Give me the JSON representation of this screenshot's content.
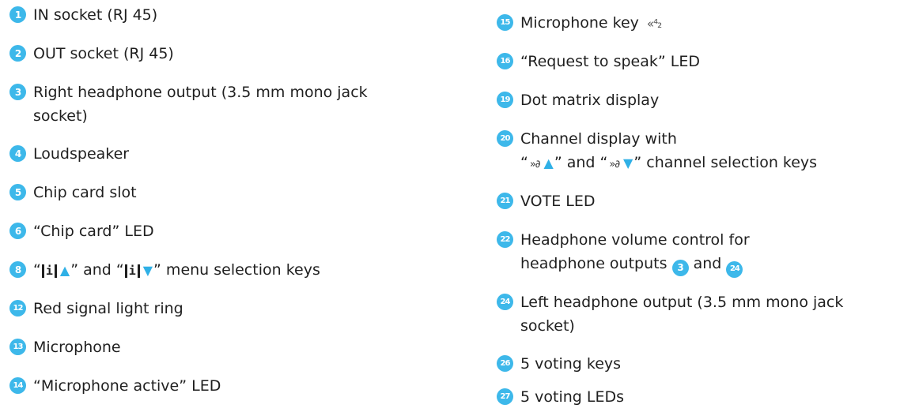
{
  "colors": {
    "badge": "#3db8ea",
    "badge_alt": "#33c6b8",
    "text": "#1f1f1f",
    "triangle": "#2fb0e6"
  },
  "symbols": {
    "open_quote": "“",
    "close_quote": "”",
    "menu_icon": "i",
    "ear_icon": "»∂",
    "up": "▲",
    "down": "▼",
    "mic_key_icon": "«⁴₂"
  },
  "left_items": [
    {
      "num": "1",
      "text": "IN socket (RJ 45)"
    },
    {
      "num": "2",
      "text": "OUT socket (RJ 45)"
    },
    {
      "num": "3",
      "text_line1": "Right headphone output (3.5 mm mono jack",
      "text_line2": "socket)"
    },
    {
      "num": "4",
      "text": "Loudspeaker"
    },
    {
      "num": "5",
      "text": "Chip card slot"
    },
    {
      "num": "6",
      "text": "“Chip card” LED"
    },
    {
      "num": "8",
      "text_and": "” and “",
      "text_tail": "” menu selection keys"
    },
    {
      "num": "12",
      "text": "Red signal light ring"
    },
    {
      "num": "13",
      "text": "Microphone"
    },
    {
      "num": "14",
      "text": "“Microphone active” LED"
    }
  ],
  "right_items": [
    {
      "num": "15",
      "text": "Microphone key"
    },
    {
      "num": "16",
      "text": "“Request to speak” LED"
    },
    {
      "num": "19",
      "text": "Dot matrix display"
    },
    {
      "num": "20",
      "text_line1": "Channel display with",
      "text_and": "” and “",
      "text_tail": "” channel selection keys"
    },
    {
      "num": "21",
      "text": "VOTE LED"
    },
    {
      "num": "22",
      "text_line1": "Headphone volume control for",
      "text_line2_a": "headphone outputs",
      "ref_a": "3",
      "text_line2_b": "and",
      "ref_b": "24"
    },
    {
      "num": "24",
      "text_line1": "Left headphone output (3.5 mm mono jack",
      "text_line2": "socket)"
    },
    {
      "num": "26",
      "text": "5 voting keys"
    },
    {
      "num": "27",
      "text": "5 voting LEDs"
    }
  ]
}
